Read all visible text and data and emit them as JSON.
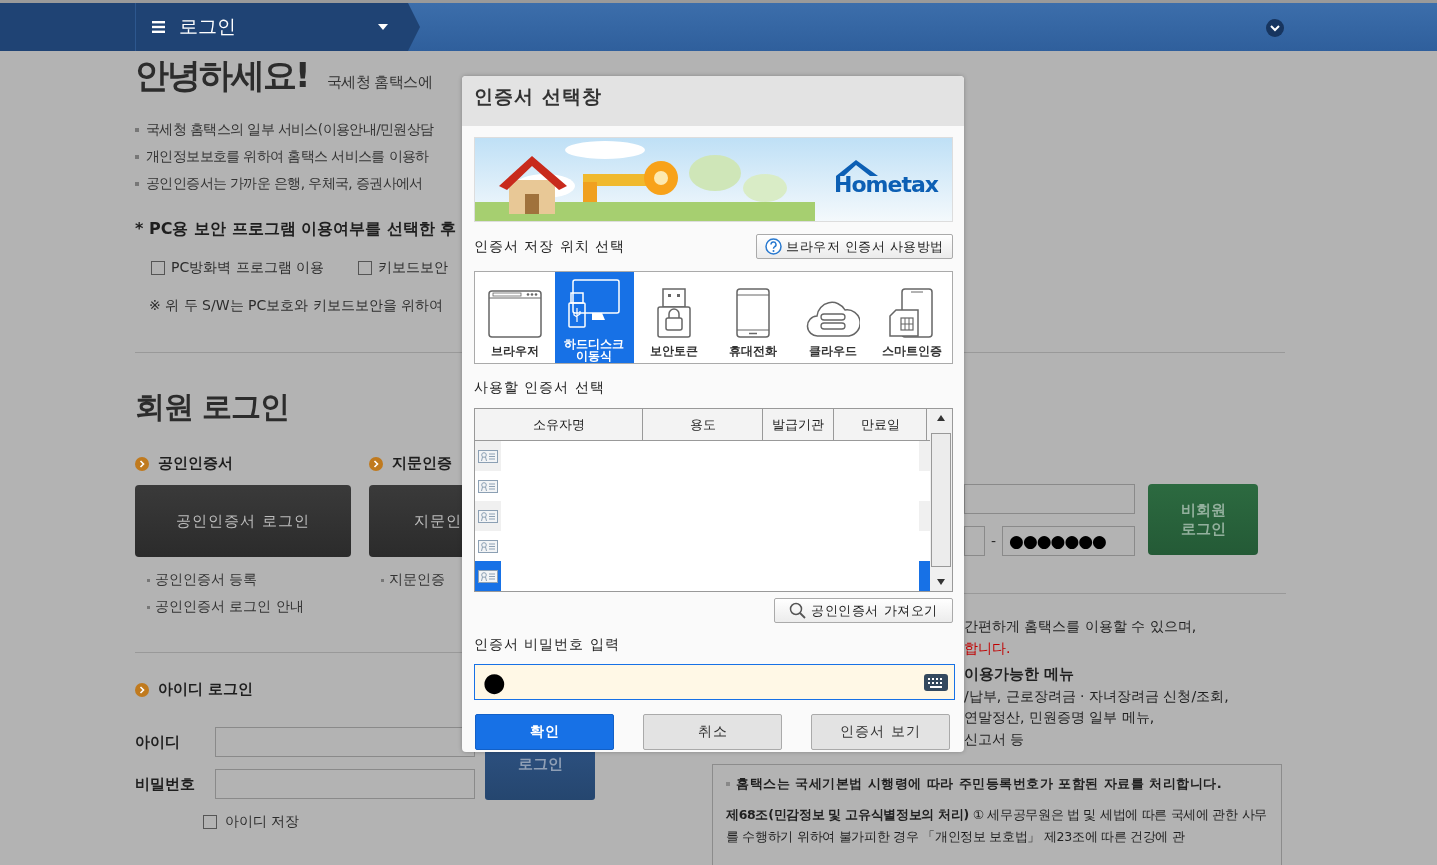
{
  "nav": {
    "title": "로그인"
  },
  "greeting": {
    "title": "안녕하세요!",
    "subtitle": "국세청 홈택스에"
  },
  "notices": [
    "국세청 홈택스의 일부 서비스(이용안내/민원상담",
    "개인정보보호를 위하여 홈택스 서비스를 이용하",
    "공인인증서는 가까운 은행, 우체국, 증권사에서"
  ],
  "security": {
    "heading": "* PC용 보안 프로그램 이용여부를 선택한 후",
    "options": [
      {
        "label": "PC방화벽 프로그램 이용",
        "checked": false
      },
      {
        "label": "키보드보안",
        "checked": false
      }
    ],
    "note": "※ 위 두 S/W는 PC보호와 키보드보안을 위하여"
  },
  "member_login": {
    "title": "회원 로그인",
    "methods": [
      {
        "heading": "공인인증서",
        "button": "공인인증서 로그인",
        "links": [
          "공인인증서 등록",
          "공인인증서 로그인 안내"
        ]
      },
      {
        "heading": "지문인증",
        "button": "지문인",
        "links": [
          "지문인증"
        ]
      }
    ]
  },
  "id_login": {
    "heading": "아이디 로그인",
    "fields": [
      {
        "label": "아이디"
      },
      {
        "label": "비밀번호"
      }
    ],
    "button": "로그인",
    "remember": {
      "label": "아이디 저장",
      "checked": false
    }
  },
  "guest_login": {
    "separator": "-",
    "masked_value": "●●●●●●●",
    "button": "비회원\n로그인"
  },
  "guest_info": [
    {
      "text": "간편하게 홈택스를 이용할 수 있으며,",
      "kind": "normal"
    },
    {
      "text": "합니다.",
      "kind": "warning"
    },
    {
      "text": "이용가능한 메뉴",
      "kind": "heading"
    },
    {
      "text": "/납부, 근로장려금 · 자녀장려금 신청/조회,",
      "kind": "normal"
    },
    {
      "text": "연말정산, 민원증명 일부 메뉴,",
      "kind": "normal"
    },
    {
      "text": "신고서 등",
      "kind": "normal"
    }
  ],
  "privacy": {
    "heading": "홈택스는 국세기본법 시행령에 따라 주민등록번호가 포함된 자료를 처리합니다.",
    "body": "**제68조(민감정보 및 고유식별정보의 처리)** ① 세무공무원은 법 및 세법에 따른 국세에 관한 사무를 수행하기 위하여 불가피한 경우 「개인정보 보호법」 제23조에 따른 건강에 관"
  },
  "dialog": {
    "title": "인증서 선택창",
    "banner": {
      "logo": "Hometax"
    },
    "storage_heading": "인증서 저장 위치 선택",
    "help_button": "브라우저 인증서 사용방법",
    "storage": [
      {
        "label": "브라우저",
        "kind": "browser",
        "selected": false
      },
      {
        "label": "하드디스크\n이동식",
        "kind": "disk",
        "selected": true
      },
      {
        "label": "보안토큰",
        "kind": "token",
        "selected": false
      },
      {
        "label": "휴대전화",
        "kind": "phone",
        "selected": false
      },
      {
        "label": "클라우드",
        "kind": "cloud",
        "selected": false
      },
      {
        "label": "스마트인증",
        "kind": "smart",
        "selected": false
      }
    ],
    "cert_heading": "사용할 인증서 선택",
    "columns": [
      "소유자명",
      "용도",
      "발급기관",
      "만료일"
    ],
    "certs": [
      {
        "selected": false
      },
      {
        "selected": false
      },
      {
        "selected": false
      },
      {
        "selected": false
      },
      {
        "selected": true
      }
    ],
    "import_button": "공인인증서 가져오기",
    "password_label": "인증서 비밀번호 입력",
    "password_value": "●",
    "buttons": [
      {
        "label": "확인",
        "kind": "primary"
      },
      {
        "label": "취소",
        "kind": "secondary"
      },
      {
        "label": "인증서 보기",
        "kind": "secondary"
      }
    ]
  }
}
